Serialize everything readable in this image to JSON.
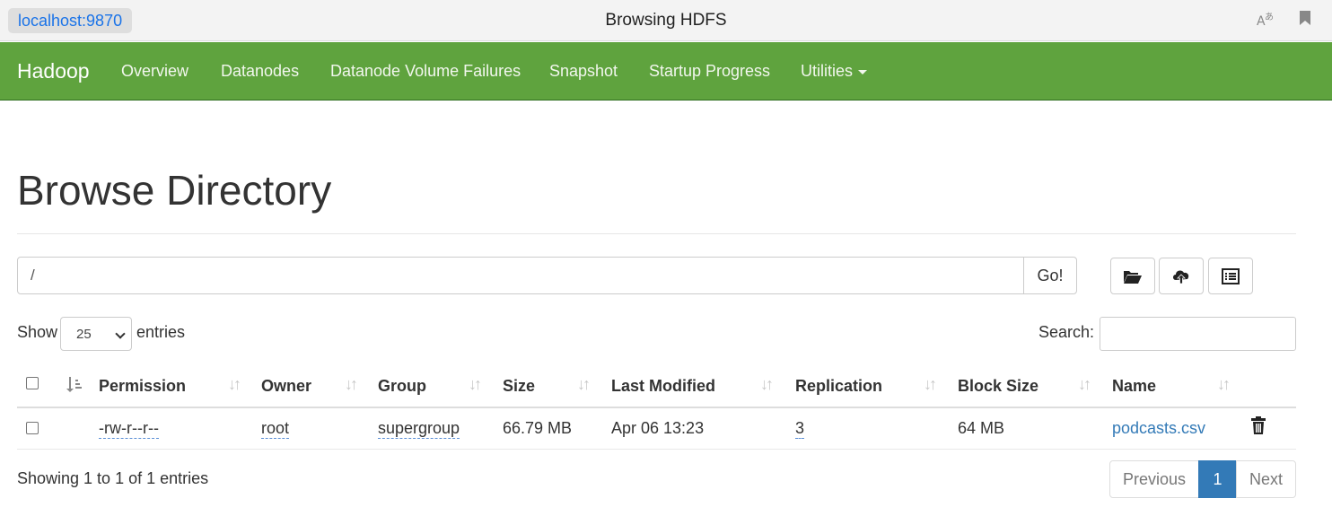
{
  "browser": {
    "url": "localhost:9870",
    "title": "Browsing HDFS"
  },
  "navbar": {
    "brand": "Hadoop",
    "items": [
      "Overview",
      "Datanodes",
      "Datanode Volume Failures",
      "Snapshot",
      "Startup Progress",
      "Utilities"
    ]
  },
  "page": {
    "title": "Browse Directory"
  },
  "path_bar": {
    "value": "/",
    "go_label": "Go!"
  },
  "toolbar": {
    "icons": [
      "folder-open-icon",
      "cloud-upload-icon",
      "list-alt-icon"
    ]
  },
  "entries": {
    "show_label": "Show",
    "selected": "25",
    "suffix_label": "entries"
  },
  "search": {
    "label": "Search:",
    "value": ""
  },
  "table": {
    "columns": [
      "Permission",
      "Owner",
      "Group",
      "Size",
      "Last Modified",
      "Replication",
      "Block Size",
      "Name"
    ],
    "rows": [
      {
        "permission": "-rw-r--r--",
        "owner": "root",
        "group": "supergroup",
        "size": "66.79 MB",
        "last_modified": "Apr 06 13:23",
        "replication": "3",
        "block_size": "64 MB",
        "name": "podcasts.csv"
      }
    ]
  },
  "footer": {
    "info": "Showing 1 to 1 of 1 entries",
    "pagination": {
      "previous": "Previous",
      "current": "1",
      "next": "Next"
    }
  }
}
